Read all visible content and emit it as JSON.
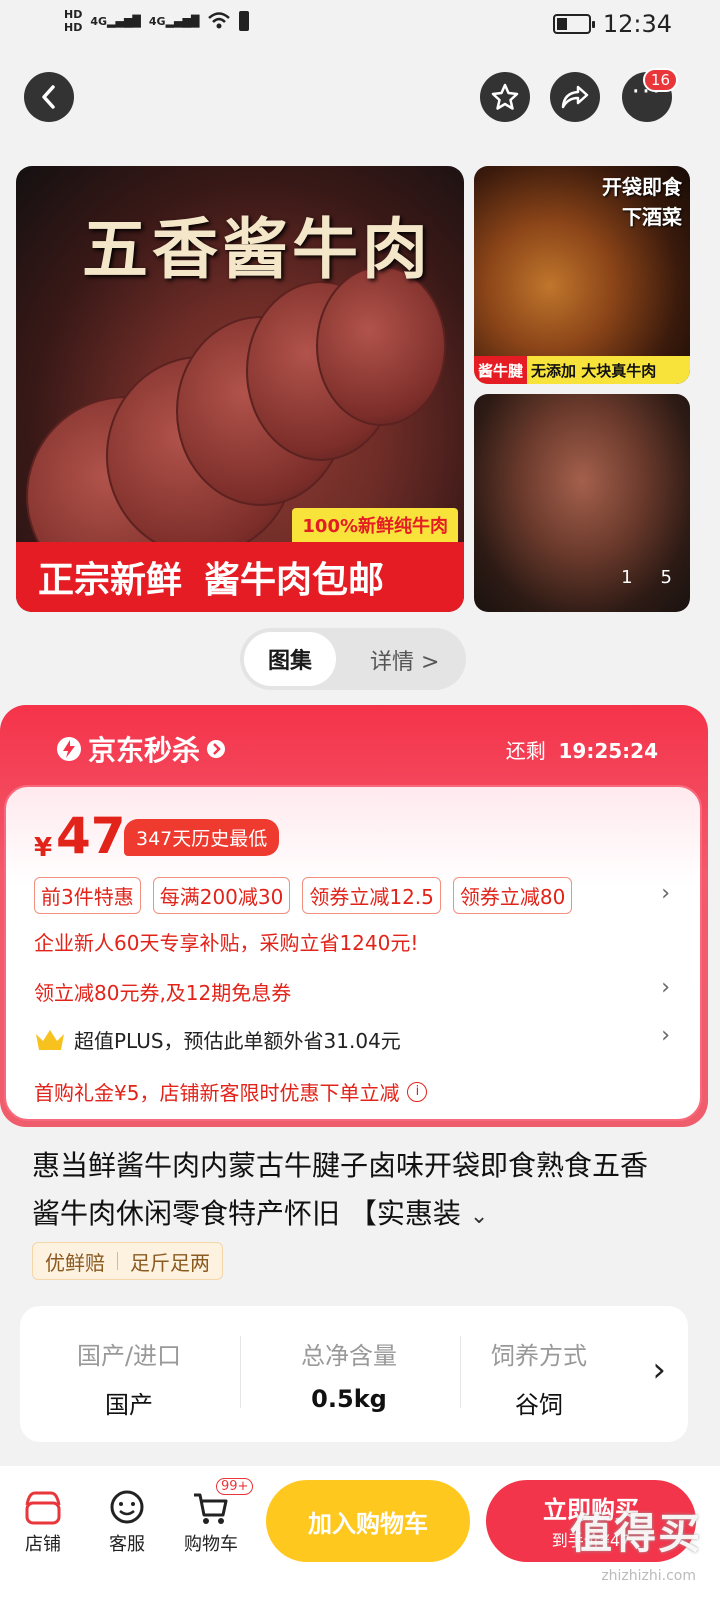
{
  "status_bar": {
    "hd1": "HD",
    "hd2": "HD",
    "net1": "4G",
    "net2": "4G",
    "time": "12:34"
  },
  "nav": {
    "cart_badge": "16"
  },
  "gallery": {
    "main_title": "五香酱牛肉",
    "main_banner_left": "正宗新鲜",
    "main_banner_right": "酱牛肉包邮",
    "main_badge": "100%新鲜纯牛肉",
    "side1_line1": "开袋即食",
    "side1_line2": "下酒菜",
    "side1_tag_red": "酱牛腱",
    "side1_tag_yellow": "无添加 大块真牛肉",
    "pager_current": "1",
    "pager_total": "5"
  },
  "tabs": {
    "active": "图集",
    "inactive": "详情 >"
  },
  "flash_sale": {
    "title": "京东秒杀",
    "timer_label": "还剩",
    "timer": "19:25:24",
    "currency": "¥",
    "price": "47",
    "lowest_label": "347天历史最低",
    "tags": [
      "前3件特惠",
      "每满200减30",
      "领券立减12.5",
      "领券立减80"
    ],
    "enterprise_line": "企业新人60天专享补贴，采购立省1240元!",
    "coupon_line": "领立减80元券,及12期免息券",
    "plus_line": "超值PLUS，预估此单额外省31.04元",
    "first_buy_line": "首购礼金¥5，店铺新客限时优惠下单立减"
  },
  "product": {
    "title": "惠当鲜酱牛肉内蒙古牛腱子卤味开袋即食熟食五香酱牛肉休闲零食特产怀旧 【实惠装",
    "guarantees": [
      "优鲜赔",
      "足斤足两"
    ]
  },
  "specs": [
    {
      "key": "国产/进口",
      "value": "国产"
    },
    {
      "key": "总净含量",
      "value": "0.5kg"
    },
    {
      "key": "饲养方式",
      "value": "谷饲"
    }
  ],
  "bottom_bar": {
    "shop": "店铺",
    "service": "客服",
    "cart": "购物车",
    "cart_badge": "99+",
    "add_to_cart": "加入购物车",
    "buy_now": "立即购买",
    "buy_now_price": "到手价¥47"
  },
  "watermark": {
    "text": "值得买",
    "site": "zhizhizhi.com"
  },
  "colors": {
    "accent_red": "#e2231a",
    "flash_red": "#f5334a",
    "cart_yellow": "#ffc81f",
    "buy_red": "#f2354b"
  }
}
